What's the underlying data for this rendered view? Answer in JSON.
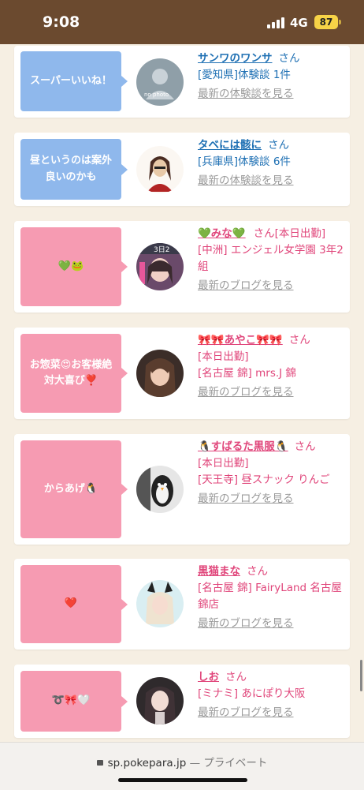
{
  "status": {
    "time": "9:08",
    "network": "4G",
    "battery": "87"
  },
  "colors": {
    "blue_bubble": "#8fb8ec",
    "pink_bubble": "#f69bb2",
    "blue_text": "#1d6fb3",
    "pink_text": "#e0457a",
    "more_link": "#9a9a9a"
  },
  "items": [
    {
      "bubble": "スーパーいいね！",
      "name": "サンワのワンサ",
      "san": "さん",
      "line1": "[愛知県]体験談 1件",
      "more": "最新の体験談を見る",
      "avatar_placeholder": "no photo"
    },
    {
      "bubble": "昼というのは案外良いのかも",
      "name": "タベには骸に",
      "san": "さん",
      "line1": "[兵庫県]体験談 6件",
      "more": "最新の体験談を見る"
    },
    {
      "bubble": "💚🐸",
      "name": "💚みな💚",
      "san": "さん",
      "today": "[本日出勤]",
      "line1": "[中洲] エンジェル女学園 3年2組",
      "more": "最新のブログを見る",
      "avatar_overlay": "3日2"
    },
    {
      "bubble": "お惣菜😍お客様絶対大喜び❣️",
      "name": "🎀🎀あやこ🎀🎀",
      "san": "さん",
      "today": "[本日出勤]",
      "line1": "[名古屋 錦] mrs.J 錦",
      "more": "最新のブログを見る"
    },
    {
      "bubble": "からあげ🐧",
      "name": "🐧すばるた黒服🐧",
      "san": "さん",
      "today": "[本日出勤]",
      "line1": "[天王寺] 昼スナック りんご",
      "more": "最新のブログを見る"
    },
    {
      "bubble": "❤️",
      "name": "黒猫まな",
      "san": "さん",
      "line1": "[名古屋 錦] FairyLand 名古屋錦店",
      "more": "最新のブログを見る"
    },
    {
      "bubble": "➰🎀🤍",
      "name": "しお",
      "san": "さん",
      "line1": "[ミナミ] あにぽり大阪",
      "more": "最新のブログを見る"
    }
  ],
  "browser": {
    "domain": "sp.pokepara.jp",
    "sub": "— プライベート"
  }
}
